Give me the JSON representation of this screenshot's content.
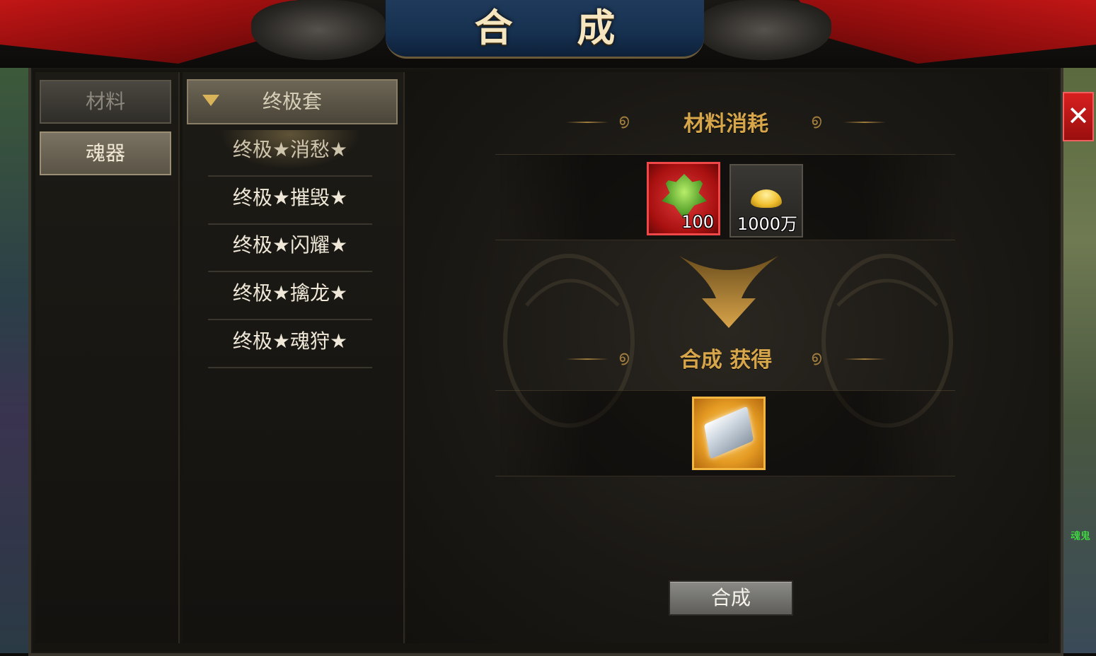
{
  "window": {
    "title": "合 成"
  },
  "categories": [
    {
      "label": "材料",
      "active": false
    },
    {
      "label": "魂器",
      "active": true
    }
  ],
  "group": {
    "label": "终极套",
    "expanded": true
  },
  "items": [
    {
      "label": "终极★消愁★",
      "selected": true
    },
    {
      "label": "终极★摧毁★",
      "selected": false
    },
    {
      "label": "终极★闪耀★",
      "selected": false
    },
    {
      "label": "终极★擒龙★",
      "selected": false
    },
    {
      "label": "终极★魂狩★",
      "selected": false
    }
  ],
  "materials": {
    "title": "材料消耗",
    "slots": [
      {
        "icon": "green-leaf-emblem-icon",
        "quantity": "100"
      },
      {
        "icon": "gold-ingot-icon",
        "quantity": "1000万"
      }
    ]
  },
  "result": {
    "title": "合成 获得",
    "icon": "silver-box-icon"
  },
  "craft_button": "合成",
  "close_icon": "close-icon",
  "world_label": "魂鬼",
  "colors": {
    "accent_gold": "#d7a64a",
    "close_red": "#c41818",
    "material_slot_red": "#d02a2a",
    "result_slot_gold": "#e9a63a"
  }
}
